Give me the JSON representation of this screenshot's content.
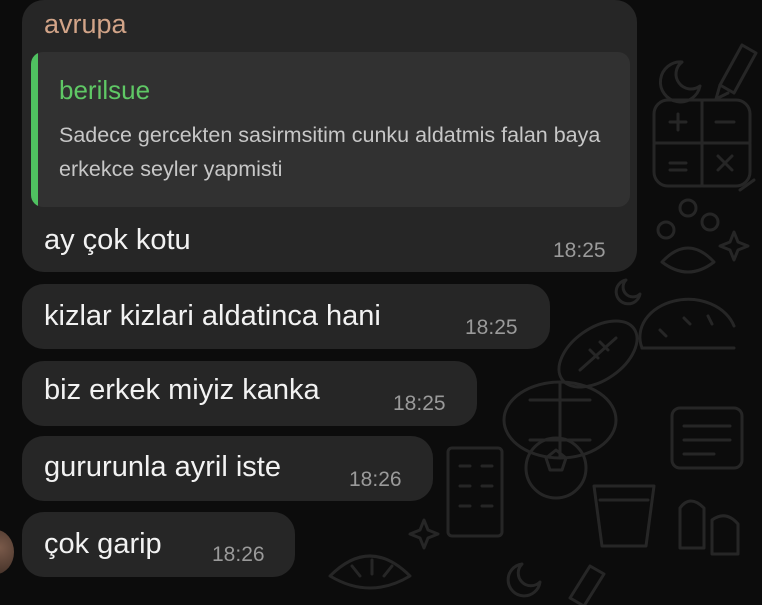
{
  "chat": {
    "background": "#0c0c0c",
    "bubble_color": "#262626"
  },
  "first_message": {
    "sender": "avrupa",
    "quote": {
      "author": "berilsue",
      "text": "Sadece gercekten sasirmsitim cunku aldatmis falan baya erkekce seyler yapmisti",
      "bar_color": "#4fc160"
    },
    "text": "ay çok kotu",
    "time": "18:25"
  },
  "messages": [
    {
      "text": "kizlar kizlari aldatinca hani",
      "time": "18:25"
    },
    {
      "text": "biz erkek miyiz kanka",
      "time": "18:25"
    },
    {
      "text": "gururunla ayril iste",
      "time": "18:26"
    },
    {
      "text": "çok garip",
      "time": "18:26"
    }
  ],
  "wallpaper": {
    "icons": [
      "calculator-icon",
      "paw-icon",
      "taco-icon",
      "football-icon",
      "turtle-icon",
      "building-icon",
      "soccer-ball-icon",
      "flower-pot-icon",
      "croissant-icon",
      "sticky-note-icon",
      "moon-icon",
      "pencil-icon",
      "sparkle-icon",
      "bone-icon"
    ]
  }
}
